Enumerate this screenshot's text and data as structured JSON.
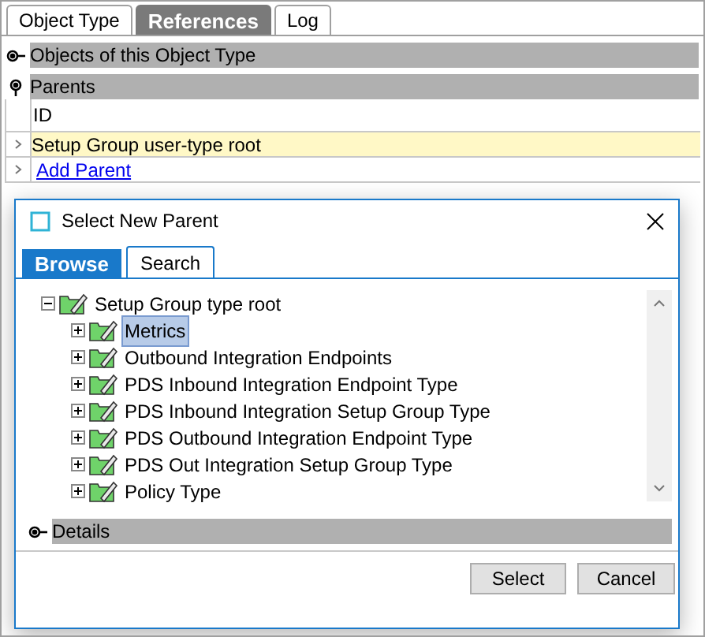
{
  "tabs": [
    {
      "label": "Object Type",
      "selected": false
    },
    {
      "label": "References",
      "selected": true
    },
    {
      "label": "Log",
      "selected": false
    }
  ],
  "sections": [
    {
      "label": "Objects of this  Object Type",
      "expanded": false
    },
    {
      "label": "Parents",
      "expanded": true
    }
  ],
  "parents_table": {
    "columns": [
      "ID"
    ],
    "rows": [
      {
        "value": "Setup Group user-type root",
        "kind": "item"
      },
      {
        "value": "Add Parent",
        "kind": "link"
      }
    ]
  },
  "dialog": {
    "title": "Select New Parent",
    "tabs": [
      {
        "label": "Browse",
        "selected": true
      },
      {
        "label": "Search",
        "selected": false
      }
    ],
    "tree": {
      "label": "Setup Group type root",
      "expanded": true,
      "selected": false,
      "children": [
        {
          "label": "Metrics",
          "expanded": false,
          "selected": true
        },
        {
          "label": "Outbound Integration Endpoints",
          "expanded": false,
          "selected": false
        },
        {
          "label": "PDS Inbound Integration Endpoint Type",
          "expanded": false,
          "selected": false
        },
        {
          "label": "PDS Inbound Integration Setup Group Type",
          "expanded": false,
          "selected": false
        },
        {
          "label": "PDS Outbound Integration Endpoint Type",
          "expanded": false,
          "selected": false
        },
        {
          "label": "PDS Out Integration Setup Group Type",
          "expanded": false,
          "selected": false
        },
        {
          "label": "Policy Type",
          "expanded": false,
          "selected": false
        }
      ]
    },
    "details": {
      "label": "Details",
      "expanded": false
    },
    "buttons": [
      "Select",
      "Cancel"
    ]
  }
}
